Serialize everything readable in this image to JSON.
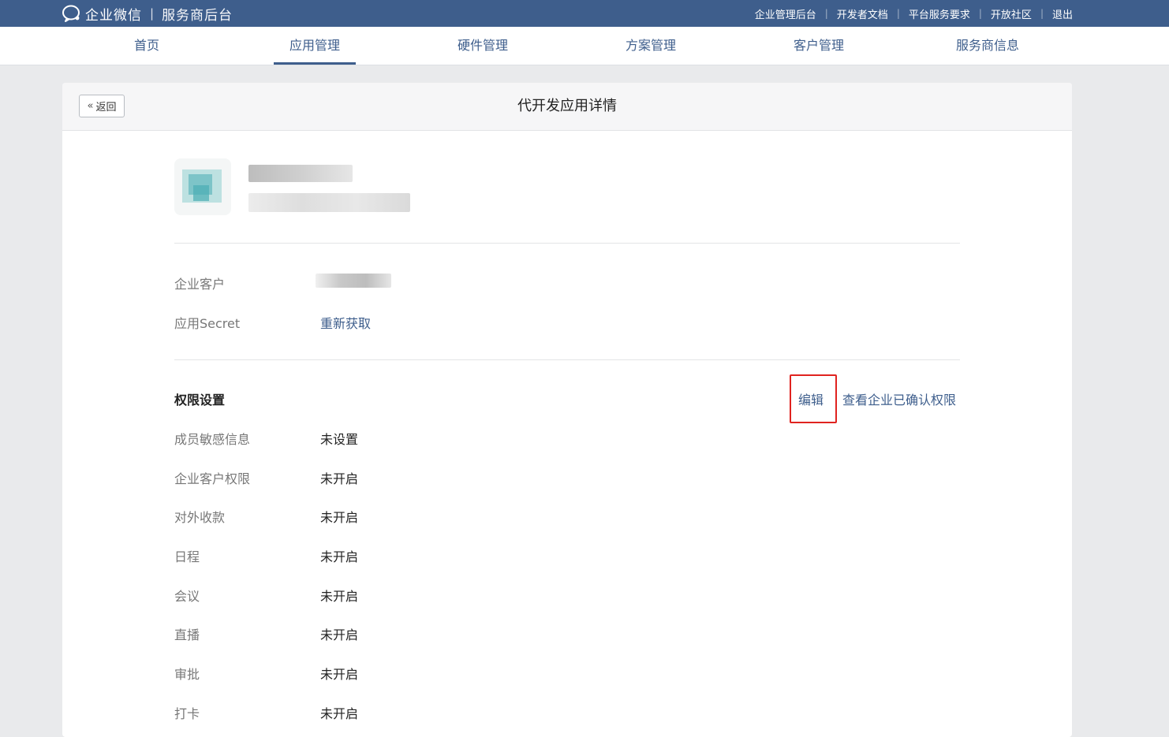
{
  "header": {
    "brand_name": "企业微信",
    "brand_separator": "|",
    "brand_sub": "服务商后台",
    "links": [
      "企业管理后台",
      "开发者文档",
      "平台服务要求",
      "开放社区",
      "退出"
    ],
    "link_separator": "|"
  },
  "nav": {
    "items": [
      {
        "label": "首页",
        "active": false
      },
      {
        "label": "应用管理",
        "active": true
      },
      {
        "label": "硬件管理",
        "active": false
      },
      {
        "label": "方案管理",
        "active": false
      },
      {
        "label": "客户管理",
        "active": false
      },
      {
        "label": "服务商信息",
        "active": false
      }
    ]
  },
  "card": {
    "back_chevron": "«",
    "back_label": "返回",
    "title": "代开发应用详情"
  },
  "details": {
    "customer_label": "企业客户",
    "secret_label": "应用Secret",
    "secret_action": "重新获取"
  },
  "permissions": {
    "title": "权限设置",
    "edit_label": "编辑",
    "view_label": "查看企业已确认权限",
    "rows": [
      {
        "label": "成员敏感信息",
        "value": "未设置"
      },
      {
        "label": "企业客户权限",
        "value": "未开启"
      },
      {
        "label": "对外收款",
        "value": "未开启"
      },
      {
        "label": "日程",
        "value": "未开启"
      },
      {
        "label": "会议",
        "value": "未开启"
      },
      {
        "label": "直播",
        "value": "未开启"
      },
      {
        "label": "审批",
        "value": "未开启"
      },
      {
        "label": "打卡",
        "value": "未开启"
      }
    ]
  },
  "colors": {
    "header_bg": "#3e5e8c",
    "link": "#3e5e8c",
    "highlight_border": "#e0231f"
  }
}
